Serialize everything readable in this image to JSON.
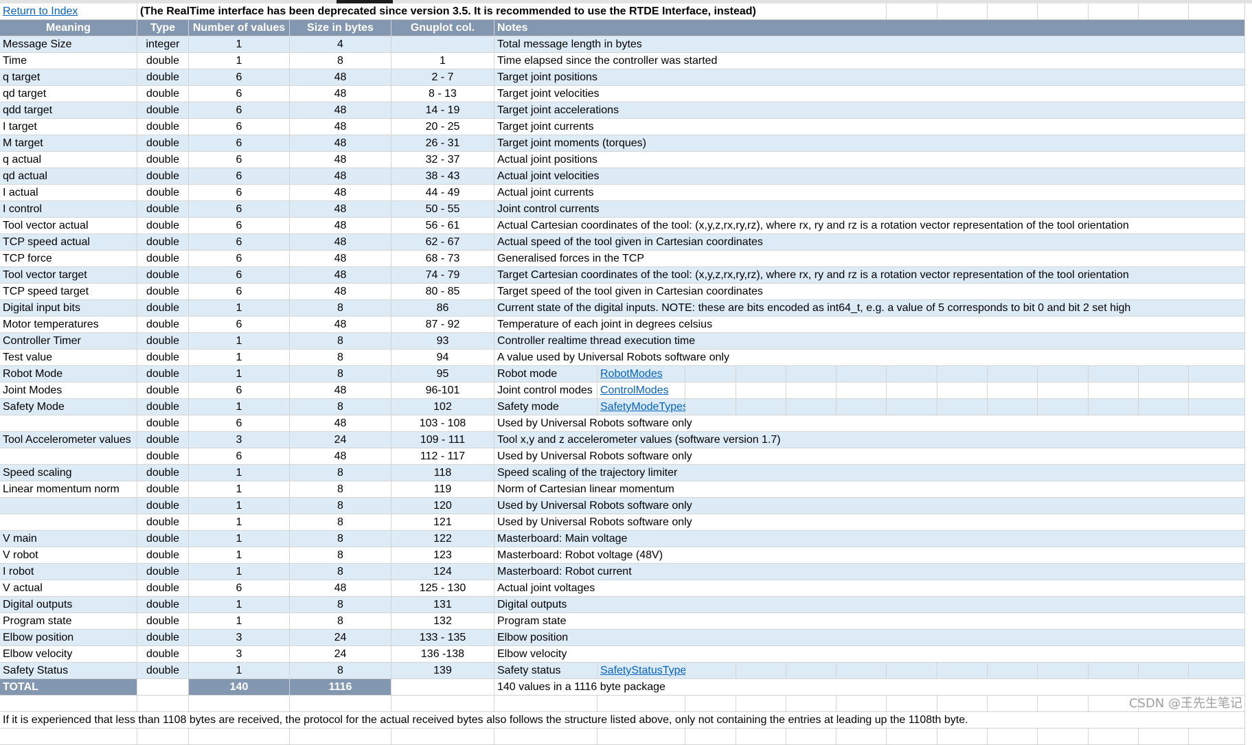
{
  "header_bar": {
    "return_link": "Return to Index",
    "notice": "(The RealTime interface has been deprecated since version 3.5. It is recommended to use the RTDE Interface, instead)"
  },
  "columns": [
    "Meaning",
    "Type",
    "Number of values",
    "Size in bytes",
    "Gnuplot col.",
    "Notes"
  ],
  "rows": [
    {
      "meaning": "Message Size",
      "type": "integer",
      "num": "1",
      "size": "4",
      "gnuplot": "",
      "notes": "Total message length in bytes"
    },
    {
      "meaning": "Time",
      "type": "double",
      "num": "1",
      "size": "8",
      "gnuplot": "1",
      "notes": "Time elapsed since the controller was started"
    },
    {
      "meaning": "q target",
      "type": "double",
      "num": "6",
      "size": "48",
      "gnuplot": "2 - 7",
      "notes": "Target joint positions"
    },
    {
      "meaning": "qd target",
      "type": "double",
      "num": "6",
      "size": "48",
      "gnuplot": "8 - 13",
      "notes": "Target joint velocities"
    },
    {
      "meaning": "qdd target",
      "type": "double",
      "num": "6",
      "size": "48",
      "gnuplot": "14 - 19",
      "notes": "Target joint accelerations"
    },
    {
      "meaning": "I target",
      "type": "double",
      "num": "6",
      "size": "48",
      "gnuplot": "20 - 25",
      "notes": "Target joint currents"
    },
    {
      "meaning": "M target",
      "type": "double",
      "num": "6",
      "size": "48",
      "gnuplot": "26 - 31",
      "notes": "Target joint moments (torques)"
    },
    {
      "meaning": "q actual",
      "type": "double",
      "num": "6",
      "size": "48",
      "gnuplot": "32 - 37",
      "notes": "Actual joint positions"
    },
    {
      "meaning": "qd actual",
      "type": "double",
      "num": "6",
      "size": "48",
      "gnuplot": "38 - 43",
      "notes": "Actual joint velocities"
    },
    {
      "meaning": "I actual",
      "type": "double",
      "num": "6",
      "size": "48",
      "gnuplot": "44 - 49",
      "notes": "Actual joint currents"
    },
    {
      "meaning": "I control",
      "type": "double",
      "num": "6",
      "size": "48",
      "gnuplot": "50 - 55",
      "notes": "Joint control currents"
    },
    {
      "meaning": "Tool vector actual",
      "type": "double",
      "num": "6",
      "size": "48",
      "gnuplot": "56 - 61",
      "notes": "Actual Cartesian coordinates of the tool: (x,y,z,rx,ry,rz), where rx, ry and rz is a rotation vector representation of the tool orientation"
    },
    {
      "meaning": "TCP speed actual",
      "type": "double",
      "num": "6",
      "size": "48",
      "gnuplot": "62 - 67",
      "notes": "Actual speed of the tool given in Cartesian coordinates"
    },
    {
      "meaning": "TCP force",
      "type": "double",
      "num": "6",
      "size": "48",
      "gnuplot": "68 - 73",
      "notes": "Generalised forces in the TCP"
    },
    {
      "meaning": "Tool vector target",
      "type": "double",
      "num": "6",
      "size": "48",
      "gnuplot": "74 - 79",
      "notes": "Target Cartesian coordinates of the tool: (x,y,z,rx,ry,rz), where rx, ry and rz is a rotation vector representation of the tool orientation"
    },
    {
      "meaning": "TCP speed target",
      "type": "double",
      "num": "6",
      "size": "48",
      "gnuplot": "80 - 85",
      "notes": "Target speed of the tool given in Cartesian coordinates"
    },
    {
      "meaning": "Digital input bits",
      "type": "double",
      "num": "1",
      "size": "8",
      "gnuplot": "86",
      "notes": "Current state of the digital inputs. NOTE: these are bits encoded as int64_t, e.g. a value of 5 corresponds to bit 0 and bit 2 set high"
    },
    {
      "meaning": "Motor temperatures",
      "type": "double",
      "num": "6",
      "size": "48",
      "gnuplot": "87 - 92",
      "notes": "Temperature of each joint in degrees celsius"
    },
    {
      "meaning": "Controller Timer",
      "type": "double",
      "num": "1",
      "size": "8",
      "gnuplot": "93",
      "notes": "Controller realtime thread execution time"
    },
    {
      "meaning": "Test value",
      "type": "double",
      "num": "1",
      "size": "8",
      "gnuplot": "94",
      "notes": "A value used by Universal Robots software only"
    },
    {
      "meaning": "Robot Mode",
      "type": "double",
      "num": "1",
      "size": "8",
      "gnuplot": "95",
      "notes": "Robot mode",
      "link": "RobotModes"
    },
    {
      "meaning": "Joint Modes",
      "type": "double",
      "num": "6",
      "size": "48",
      "gnuplot": "96-101",
      "notes": "Joint control modes",
      "link": "ControlModes"
    },
    {
      "meaning": "Safety Mode",
      "type": "double",
      "num": "1",
      "size": "8",
      "gnuplot": "102",
      "notes": "Safety mode",
      "link": "SafetyModeTypes"
    },
    {
      "meaning": "",
      "type": "double",
      "num": "6",
      "size": "48",
      "gnuplot": "103 - 108",
      "notes": "Used by Universal Robots software only"
    },
    {
      "meaning": "Tool Accelerometer values",
      "type": "double",
      "num": "3",
      "size": "24",
      "gnuplot": "109 - 111",
      "notes": "Tool x,y and z accelerometer values (software version 1.7)"
    },
    {
      "meaning": "",
      "type": "double",
      "num": "6",
      "size": "48",
      "gnuplot": "112 - 117",
      "notes": "Used by Universal Robots software only"
    },
    {
      "meaning": "Speed scaling",
      "type": "double",
      "num": "1",
      "size": "8",
      "gnuplot": "118",
      "notes": "Speed scaling of the trajectory limiter"
    },
    {
      "meaning": "Linear momentum norm",
      "type": "double",
      "num": "1",
      "size": "8",
      "gnuplot": "119",
      "notes": "Norm of Cartesian linear momentum"
    },
    {
      "meaning": "",
      "type": "double",
      "num": "1",
      "size": "8",
      "gnuplot": "120",
      "notes": "Used by Universal Robots software only"
    },
    {
      "meaning": "",
      "type": "double",
      "num": "1",
      "size": "8",
      "gnuplot": "121",
      "notes": "Used by Universal Robots software only"
    },
    {
      "meaning": "V main",
      "type": "double",
      "num": "1",
      "size": "8",
      "gnuplot": "122",
      "notes": "Masterboard: Main voltage"
    },
    {
      "meaning": "V robot",
      "type": "double",
      "num": "1",
      "size": "8",
      "gnuplot": "123",
      "notes": "Masterboard: Robot voltage (48V)"
    },
    {
      "meaning": "I robot",
      "type": "double",
      "num": "1",
      "size": "8",
      "gnuplot": "124",
      "notes": "Masterboard: Robot current"
    },
    {
      "meaning": "V actual",
      "type": "double",
      "num": "6",
      "size": "48",
      "gnuplot": "125 - 130",
      "notes": "Actual joint voltages"
    },
    {
      "meaning": "Digital outputs",
      "type": "double",
      "num": "1",
      "size": "8",
      "gnuplot": "131",
      "notes": "Digital outputs"
    },
    {
      "meaning": "Program state",
      "type": "double",
      "num": "1",
      "size": "8",
      "gnuplot": "132",
      "notes": "Program state"
    },
    {
      "meaning": "Elbow position",
      "type": "double",
      "num": "3",
      "size": "24",
      "gnuplot": "133 - 135",
      "notes": "Elbow position"
    },
    {
      "meaning": "Elbow velocity",
      "type": "double",
      "num": "3",
      "size": "24",
      "gnuplot": "136 -138",
      "notes": "Elbow velocity"
    },
    {
      "meaning": "Safety Status",
      "type": "double",
      "num": "1",
      "size": "8",
      "gnuplot": "139",
      "notes": "Safety status",
      "link": "SafetyStatusTypes"
    }
  ],
  "total": {
    "label": "TOTAL",
    "num": "140",
    "size": "1116",
    "notes": "140 values in a 1116 byte package"
  },
  "footer_note": "If it is experienced that less than 1108 bytes are received, the protocol for the actual received bytes also follows the structure listed above, only not containing the entries at leading up the 1108th byte.",
  "watermark": "CSDN @王先生笔记",
  "colors": {
    "header_bg": "#8497b0",
    "band_bg": "#ddebf7",
    "link": "#0563c1",
    "grid": "#d4d4d4"
  }
}
